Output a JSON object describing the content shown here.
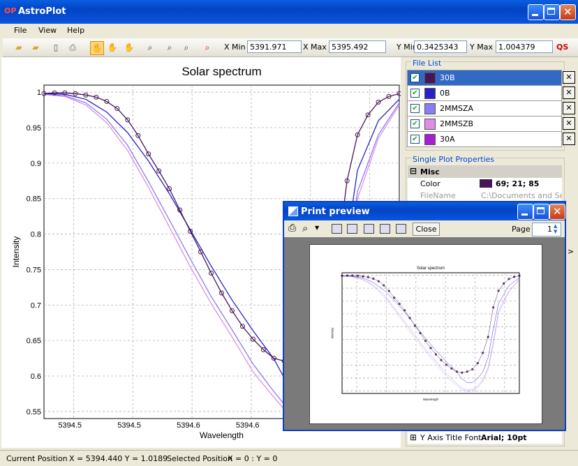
{
  "app": {
    "title": "AstroPlot"
  },
  "menu": [
    "File",
    "View",
    "Help"
  ],
  "toolbar": {
    "xmin_label": "X Min",
    "xmin_value": "5391.971",
    "xmax_label": "X Max",
    "xmax_value": "5395.492",
    "ymin_label": "Y Min",
    "ymin_value": "0.3425343",
    "ymax_label": "Y Max",
    "ymax_value": "1.004379",
    "qs_label": "QS"
  },
  "file_list": {
    "title": "File List",
    "items": [
      {
        "name": "30B",
        "color": "#451555",
        "selected": true
      },
      {
        "name": "0B",
        "color": "#2a1fc8",
        "selected": false
      },
      {
        "name": "2MMSZA",
        "color": "#8a7cf2",
        "selected": false
      },
      {
        "name": "2MMSZB",
        "color": "#e08ce8",
        "selected": false
      },
      {
        "name": "30A",
        "color": "#a81dd2",
        "selected": false
      }
    ]
  },
  "props": {
    "title": "Single Plot Properties",
    "section": "Misc",
    "color_label": "Color",
    "color_value": "69; 21; 85",
    "filename_label": "FileName",
    "filename_value": "C:\\Documents and Setti",
    "yaxis_font_label": "Y Axis Title Font",
    "yaxis_font_value": "Arial; 10pt"
  },
  "status": {
    "current_label": "Current Position",
    "current_value": "X = 5394.440 Y = 1.0189",
    "selected_label": "Selected Position",
    "selected_value": "X = 0 : Y = 0"
  },
  "print_preview": {
    "title": "Print preview",
    "close_label": "Close",
    "page_label": "Page",
    "page_value": "1"
  },
  "chart_data": {
    "type": "line",
    "title": "Solar spectrum",
    "xlabel": "Wavelength",
    "ylabel": "Intensity",
    "xlim": [
      5394.45,
      5394.79
    ],
    "ylim": [
      0.54,
      1.01
    ],
    "x_ticks": [
      "5394.5",
      "5394.5",
      "5394.6",
      "5394.6",
      "5394.7",
      "5394.7"
    ],
    "y_ticks": [
      1,
      0.95,
      0.9,
      0.85,
      0.8,
      0.75,
      0.7,
      0.65,
      0.6,
      0.55
    ],
    "grid": true,
    "series": [
      {
        "name": "30B",
        "color": "#451555",
        "markers": true,
        "x": [
          5394.45,
          5394.46,
          5394.47,
          5394.48,
          5394.49,
          5394.5,
          5394.51,
          5394.52,
          5394.53,
          5394.54,
          5394.55,
          5394.56,
          5394.57,
          5394.58,
          5394.59,
          5394.6,
          5394.61,
          5394.62,
          5394.63,
          5394.64,
          5394.65,
          5394.66,
          5394.67,
          5394.68,
          5394.69,
          5394.7,
          5394.71,
          5394.72,
          5394.73,
          5394.74,
          5394.75,
          5394.76,
          5394.77,
          5394.78,
          5394.79
        ],
        "y": [
          0.998,
          0.999,
          0.999,
          0.998,
          0.996,
          0.993,
          0.987,
          0.977,
          0.961,
          0.939,
          0.913,
          0.889,
          0.864,
          0.834,
          0.804,
          0.775,
          0.745,
          0.717,
          0.692,
          0.67,
          0.652,
          0.637,
          0.625,
          0.621,
          0.625,
          0.634,
          0.658,
          0.698,
          0.76,
          0.875,
          0.94,
          0.968,
          0.986,
          0.994,
          0.998
        ]
      },
      {
        "name": "0B",
        "color": "#2a1fc8",
        "markers": false,
        "x": [
          5394.45,
          5394.47,
          5394.49,
          5394.51,
          5394.53,
          5394.55,
          5394.57,
          5394.59,
          5394.61,
          5394.63,
          5394.65,
          5394.67,
          5394.68,
          5394.69,
          5394.7,
          5394.71,
          5394.72,
          5394.73,
          5394.74,
          5394.75,
          5394.77,
          5394.79
        ],
        "y": [
          0.998,
          0.997,
          0.99,
          0.972,
          0.943,
          0.903,
          0.857,
          0.806,
          0.755,
          0.707,
          0.664,
          0.624,
          0.597,
          0.582,
          0.583,
          0.598,
          0.625,
          0.68,
          0.79,
          0.89,
          0.96,
          0.99
        ]
      },
      {
        "name": "2MMSZA",
        "color": "#8a7cf2",
        "markers": false,
        "x": [
          5394.45,
          5394.47,
          5394.49,
          5394.51,
          5394.53,
          5394.55,
          5394.57,
          5394.59,
          5394.61,
          5394.63,
          5394.65,
          5394.67,
          5394.68,
          5394.69,
          5394.7,
          5394.71,
          5394.72,
          5394.73,
          5394.74,
          5394.75,
          5394.77,
          5394.79
        ],
        "y": [
          0.997,
          0.995,
          0.985,
          0.962,
          0.925,
          0.874,
          0.82,
          0.765,
          0.712,
          0.665,
          0.617,
          0.578,
          0.56,
          0.553,
          0.555,
          0.568,
          0.593,
          0.64,
          0.74,
          0.86,
          0.94,
          0.985
        ]
      },
      {
        "name": "2MMSZB",
        "color": "#e08ce8",
        "markers": false,
        "x": [
          5394.45,
          5394.47,
          5394.49,
          5394.51,
          5394.53,
          5394.55,
          5394.57,
          5394.59,
          5394.61,
          5394.63,
          5394.65,
          5394.67,
          5394.68,
          5394.69,
          5394.7,
          5394.71,
          5394.72,
          5394.73,
          5394.74,
          5394.75,
          5394.77,
          5394.79
        ],
        "y": [
          0.997,
          0.994,
          0.982,
          0.957,
          0.918,
          0.866,
          0.81,
          0.754,
          0.702,
          0.655,
          0.606,
          0.57,
          0.553,
          0.547,
          0.549,
          0.562,
          0.588,
          0.632,
          0.725,
          0.85,
          0.935,
          0.982
        ]
      }
    ]
  }
}
